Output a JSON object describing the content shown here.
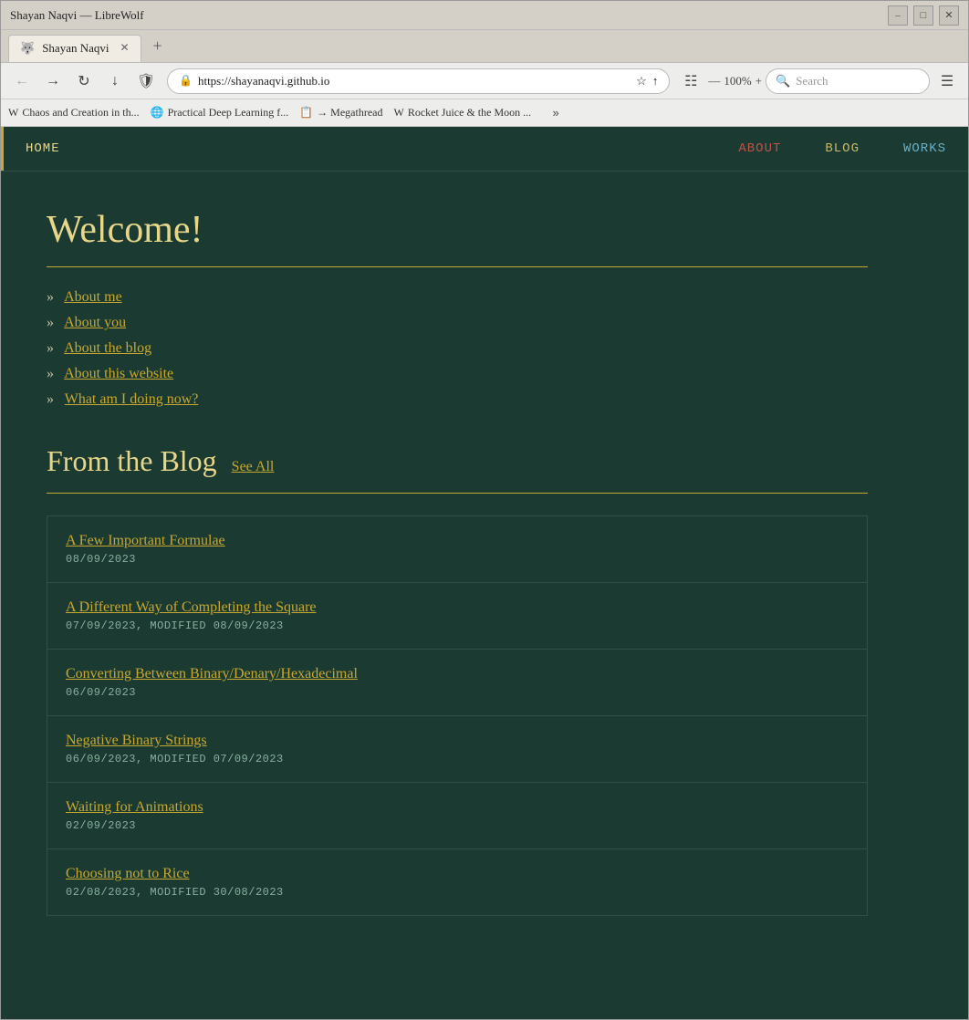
{
  "browser": {
    "title": "Shayan Naqvi — LibreWolf",
    "tab": {
      "icon": "🐺",
      "label": "Shayan Naqvi"
    },
    "address": "https://shayanaqvi.github.io",
    "zoom": "100%",
    "search_placeholder": "Search"
  },
  "bookmarks": [
    {
      "icon": "W",
      "label": "Chaos and Creation in th..."
    },
    {
      "icon": "🌐",
      "label": "Practical Deep Learning f..."
    },
    {
      "icon": "📋",
      "label": "→ Megathread"
    },
    {
      "icon": "W",
      "label": "Rocket Juice & the Moon ..."
    }
  ],
  "nav": {
    "items": [
      {
        "label": "HOME",
        "key": "home",
        "active": true
      },
      {
        "label": "ABOUT",
        "key": "about"
      },
      {
        "label": "BLOG",
        "key": "blog"
      },
      {
        "label": "WORKS",
        "key": "works"
      }
    ]
  },
  "home": {
    "welcome": "Welcome!",
    "links": [
      {
        "label": "About me",
        "href": "#"
      },
      {
        "label": "About you",
        "href": "#"
      },
      {
        "label": "About the blog",
        "href": "#"
      },
      {
        "label": "About this website",
        "href": "#"
      },
      {
        "label": "What am I doing now?",
        "href": "#"
      }
    ],
    "blog_section": {
      "title": "From the Blog",
      "see_all": "See All",
      "posts": [
        {
          "title": "A Few Important Formulae",
          "date": "08/09/2023",
          "modified": null
        },
        {
          "title": "A Different Way of Completing the Square",
          "date": "07/09/2023",
          "modified": "08/09/2023"
        },
        {
          "title": "Converting Between Binary/Denary/Hexadecimal",
          "date": "06/09/2023",
          "modified": null
        },
        {
          "title": "Negative Binary Strings",
          "date": "06/09/2023",
          "modified": "07/09/2023"
        },
        {
          "title": "Waiting for Animations",
          "date": "02/09/2023",
          "modified": null
        },
        {
          "title": "Choosing not to Rice",
          "date": "02/08/2023",
          "modified": "30/08/2023"
        }
      ]
    }
  }
}
